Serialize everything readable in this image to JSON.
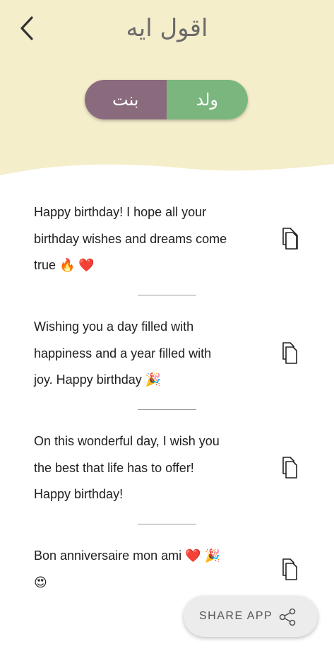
{
  "header": {
    "title": "اقول ايه",
    "background_color": "#f5eecb"
  },
  "toggle": {
    "girl_label": "بنت",
    "boy_label": "ولد",
    "girl_color": "#8a6b7e",
    "boy_color": "#7bb67f",
    "selected": "boy"
  },
  "messages": [
    {
      "lines": [
        "Happy birthday! I hope all your",
        "birthday wishes and dreams come",
        "true 🔥 ❤️"
      ]
    },
    {
      "lines": [
        "Wishing you a day filled with",
        "happiness and a year filled with",
        "joy. Happy birthday 🎉"
      ]
    },
    {
      "lines": [
        "On this wonderful day, I wish you",
        "the best that life has to offer!",
        "Happy birthday!"
      ]
    },
    {
      "lines": [
        "Bon anniversaire mon ami ❤️ 🎉",
        "😍"
      ]
    }
  ],
  "share": {
    "label": "SHARE APP"
  },
  "icons": {
    "back": "chevron-left-icon",
    "copy": "copy-icon",
    "share": "share-icon"
  }
}
